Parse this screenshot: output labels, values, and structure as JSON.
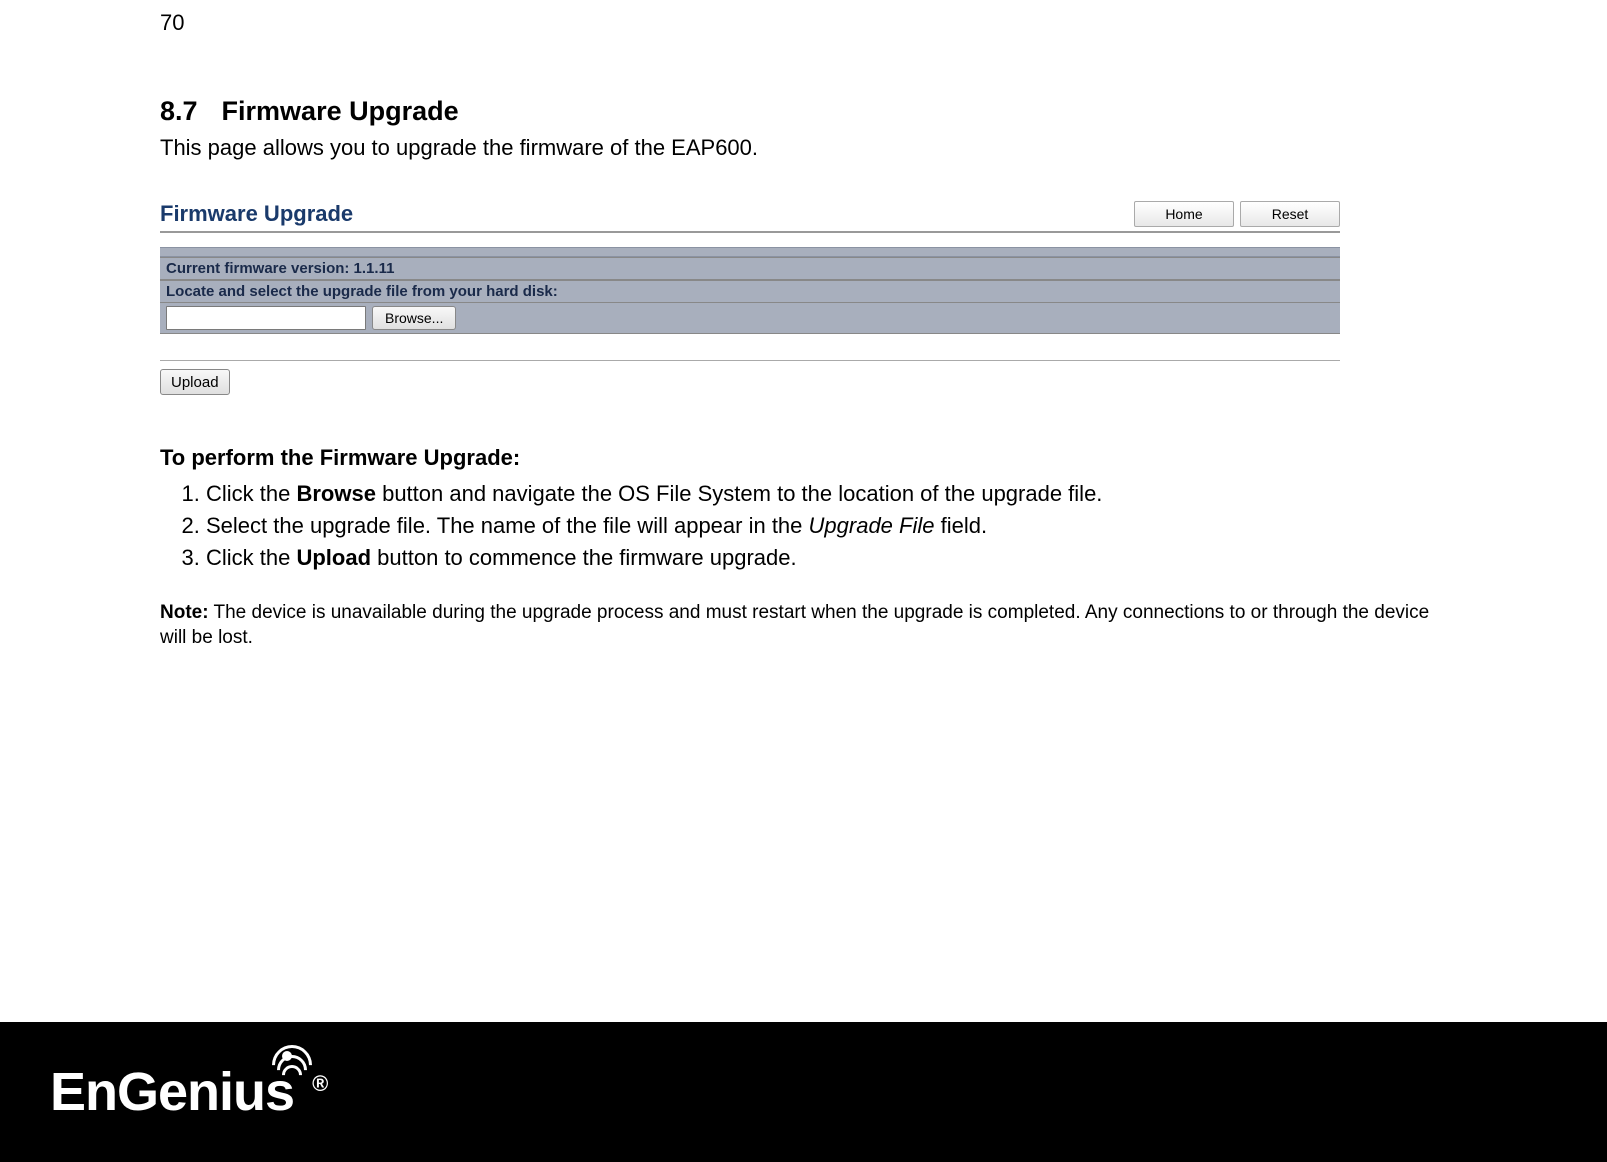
{
  "page_number": "70",
  "section": {
    "number": "8.7",
    "title": "Firmware Upgrade"
  },
  "intro": "This page allows you to upgrade the firmware of the EAP600.",
  "ui": {
    "title": "Firmware Upgrade",
    "home_btn": "Home",
    "reset_btn": "Reset",
    "version_row": "Current firmware version: 1.1.11",
    "locate_row": "Locate and select the upgrade file from your hard disk:",
    "browse_btn": "Browse...",
    "upload_btn": "Upload"
  },
  "instructions_heading": "To perform the Firmware Upgrade:",
  "steps": {
    "s1a": "Click the ",
    "s1b": "Browse",
    "s1c": " button and navigate the OS File System to the location of the upgrade file.",
    "s2a": "Select the upgrade file. The name of the file will appear in the ",
    "s2b": "Upgrade File",
    "s2c": " field.",
    "s3a": "Click the ",
    "s3b": "Upload",
    "s3c": " button to commence the firmware upgrade."
  },
  "note": {
    "label": "Note:",
    "text": " The device is unavailable during the upgrade process and must restart when the upgrade is completed. Any connections to or through the device will be lost."
  },
  "logo": {
    "text": "EnGenius",
    "reg": "®"
  }
}
